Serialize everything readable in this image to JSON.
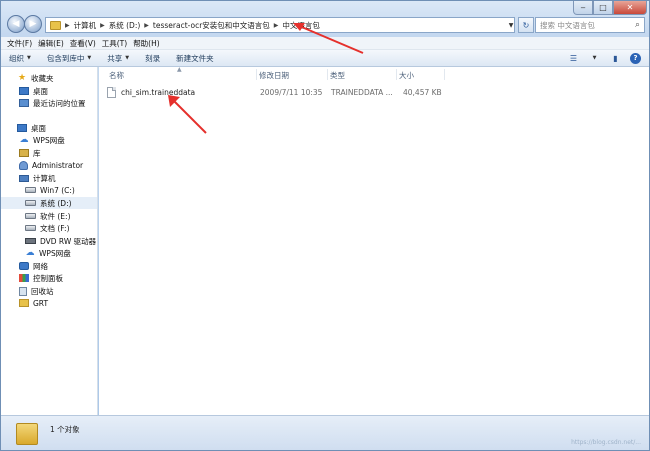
{
  "address": {
    "crumbs": [
      "计算机",
      "系统 (D:)",
      "tesseract-ocr安装包和中文语言包",
      "中文语言包"
    ],
    "search_placeholder": "搜索 中文语言包"
  },
  "menu": {
    "items": [
      "文件(F)",
      "编辑(E)",
      "查看(V)",
      "工具(T)",
      "帮助(H)"
    ]
  },
  "toolbar": {
    "organize": "组织",
    "include_library": "包含到库中",
    "share": "共享",
    "burn": "刻录",
    "new_folder": "新建文件夹"
  },
  "nav": {
    "favorites": "收藏夹",
    "desktop_fav": "桌面",
    "recent": "最近访问的位置",
    "desktop": "桌面",
    "wps_cloud": "WPS网盘",
    "library": "库",
    "admin": "Administrator",
    "computer": "计算机",
    "drive_c": "Win7 (C:)",
    "drive_d": "系统 (D:)",
    "drive_e": "软件 (E:)",
    "drive_f": "文档 (F:)",
    "drive_dvd": "DVD RW 驱动器 (G",
    "wps_cloud2": "WPS网盘",
    "network": "网络",
    "control_panel": "控制面板",
    "recycle_bin": "回收站",
    "grt": "GRT"
  },
  "columns": {
    "name": "名称",
    "modified": "修改日期",
    "type": "类型",
    "size": "大小"
  },
  "files": [
    {
      "name": "chi_sim.traineddata",
      "modified": "2009/7/11 10:35",
      "type": "TRAINEDDATA ...",
      "size": "40,457 KB"
    }
  ],
  "status": {
    "count": "1 个对象",
    "watermark": "https://blog.csdn.net/..."
  },
  "colors": {
    "annotation": "#e5302c",
    "accent": "#3d79c7"
  }
}
